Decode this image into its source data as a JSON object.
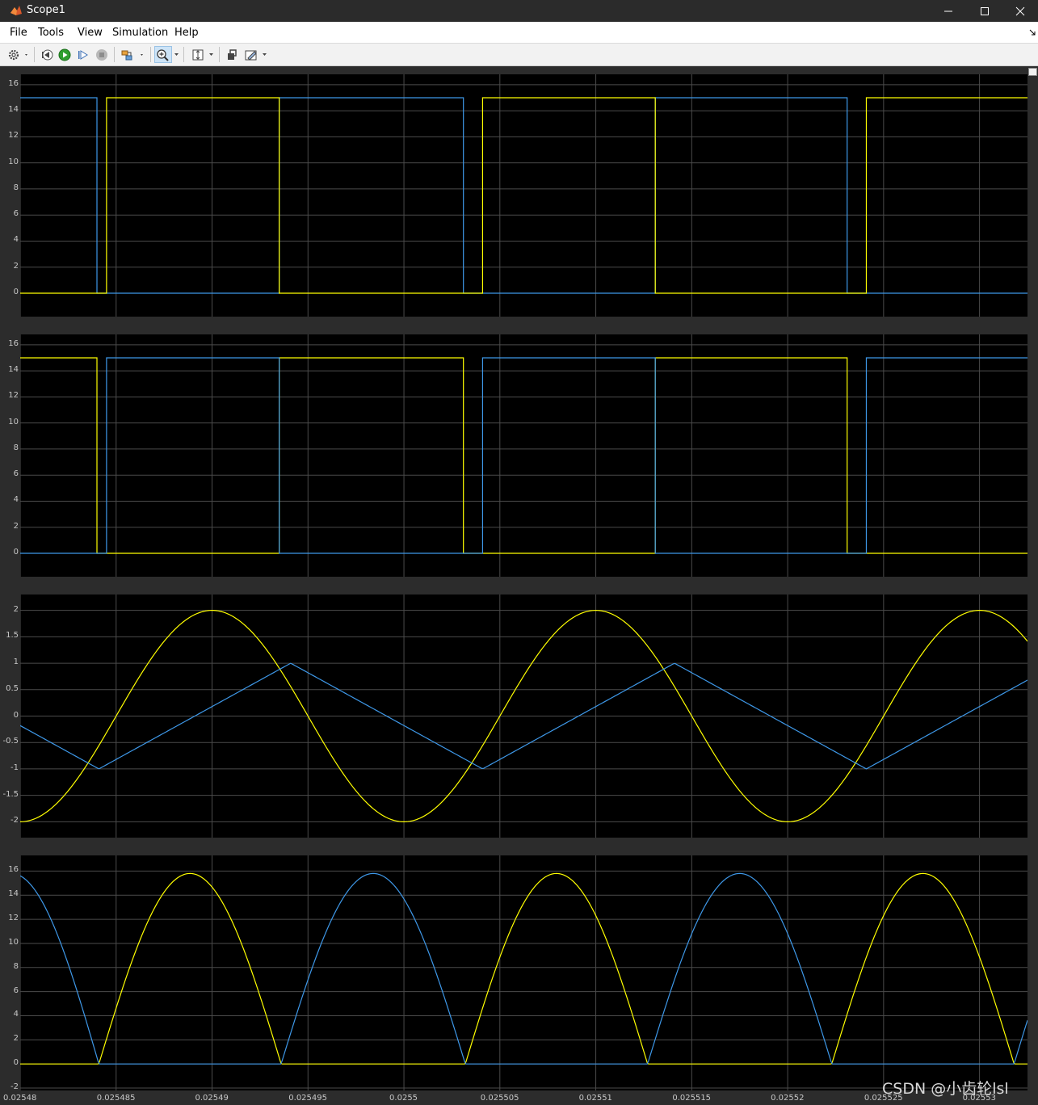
{
  "window": {
    "title": "Scope1",
    "controls": {
      "minimize_icon": "minimize-icon",
      "maximize_icon": "maximize-icon",
      "close_icon": "close-icon"
    }
  },
  "menu": {
    "items": [
      "File",
      "Tools",
      "View",
      "Simulation",
      "Help"
    ]
  },
  "toolbar": {
    "buttons": [
      "gear-icon",
      "step-back-icon",
      "run-icon",
      "step-forward-icon",
      "stop-icon",
      "highlight-block-icon",
      "zoom-in-icon",
      "scale-axes-icon",
      "restore-layout-icon",
      "style-icon"
    ],
    "active": "zoom-in-icon"
  },
  "colors": {
    "series_yellow": "#ffff00",
    "series_blue": "#3e98e8",
    "plot_bg": "#000000",
    "grid": "#4b4b4b",
    "frame": "#2c2c2c"
  },
  "x_ticks": [
    "0.02548",
    "0.025485",
    "0.02549",
    "0.025495",
    "0.0255",
    "0.025505",
    "0.02551",
    "0.025515",
    "0.02552",
    "0.025525",
    "0.02553"
  ],
  "chart_data": [
    {
      "type": "line",
      "xlim": [
        0.02548,
        0.0255325
      ],
      "ylim": [
        -1.8,
        16.8
      ],
      "yticks": [
        "16",
        "14",
        "12",
        "10",
        "8",
        "6",
        "4",
        "2",
        "0"
      ],
      "grid": true,
      "series": [
        {
          "color": "#3e98e8",
          "kind": "pulse",
          "high": 15,
          "low": 0,
          "high_intervals": [
            [
              0.02548,
              0.025484
            ],
            [
              0.0254935,
              0.0254935
            ],
            [
              0.0254935,
              0.0255031
            ],
            [
              0.0255131,
              0.0255231
            ],
            [
              0.0255328,
              0.0255325
            ]
          ]
        },
        {
          "color": "#ffff00",
          "kind": "pulse",
          "high": 15,
          "low": 0,
          "high_intervals": [
            [
              0.0254845,
              0.0254935
            ],
            [
              0.0255041,
              0.0255131
            ],
            [
              0.0255241,
              0.0255325
            ]
          ]
        }
      ]
    },
    {
      "type": "line",
      "xlim": [
        0.02548,
        0.0255325
      ],
      "ylim": [
        -1.8,
        16.8
      ],
      "yticks": [
        "16",
        "14",
        "12",
        "10",
        "8",
        "6",
        "4",
        "2",
        "0"
      ],
      "grid": true,
      "series": [
        {
          "color": "#ffff00",
          "kind": "pulse",
          "high": 15,
          "low": 0,
          "high_intervals": [
            [
              0.02548,
              0.025484
            ],
            [
              0.0254935,
              0.0255031
            ],
            [
              0.0255131,
              0.0255231
            ]
          ]
        },
        {
          "color": "#3e98e8",
          "kind": "pulse",
          "high": 15,
          "low": 0,
          "high_intervals": [
            [
              0.0254845,
              0.0254935
            ],
            [
              0.0255041,
              0.0255131
            ],
            [
              0.0255241,
              0.0255325
            ]
          ]
        }
      ]
    },
    {
      "type": "line",
      "xlim": [
        0.02548,
        0.0255325
      ],
      "ylim": [
        -2.3,
        2.3
      ],
      "yticks": [
        "2",
        "1.5",
        "1",
        "0.5",
        "0",
        "-0.5",
        "-1",
        "-1.5",
        "-2"
      ],
      "grid": true,
      "series": [
        {
          "color": "#ffff00",
          "kind": "sine",
          "amplitude": 2,
          "period": 2e-05,
          "peak_at": 0.02549
        },
        {
          "color": "#3e98e8",
          "kind": "triangle",
          "amplitude": 1,
          "period": 2e-05,
          "peak_at": 0.0254936,
          "trough_at": 0.0254841
        }
      ]
    },
    {
      "type": "line",
      "xlim": [
        0.02548,
        0.0255325
      ],
      "ylim": [
        -2.2,
        17.3
      ],
      "yticks": [
        "16",
        "14",
        "12",
        "10",
        "8",
        "6",
        "4",
        "2",
        "0",
        "-2"
      ],
      "grid": true,
      "series": [
        {
          "color": "#ffff00",
          "kind": "rectified-half",
          "amplitude": 15.8,
          "lobes": [
            [
              0.0254841,
              0.0254936
            ],
            [
              0.0255032,
              0.0255127
            ],
            [
              0.0255223,
              0.0255318
            ]
          ]
        },
        {
          "color": "#3e98e8",
          "kind": "rectified-half",
          "amplitude": 15.8,
          "lobes": [
            [
              0.025475,
              0.0254841
            ],
            [
              0.0254936,
              0.0255032
            ],
            [
              0.0255127,
              0.0255223
            ],
            [
              0.0255318,
              0.0255413
            ]
          ]
        }
      ]
    }
  ],
  "watermark": "CSDN @小齿轮lsl"
}
